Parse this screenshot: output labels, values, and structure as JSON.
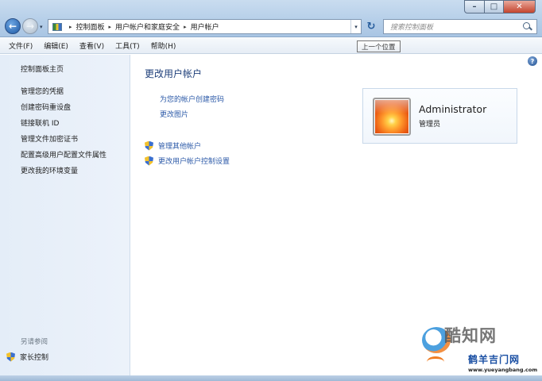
{
  "window": {
    "controls": {
      "minimize": "–",
      "maximize": "□",
      "close": "✕"
    }
  },
  "navigation": {
    "back": "←",
    "forward": "→",
    "history_dropdown": "▾"
  },
  "address_bar": {
    "breadcrumbs": [
      "控制面板",
      "用户帐户和家庭安全",
      "用户帐户"
    ],
    "dropdown": "▾"
  },
  "refresh_button": "↻",
  "search": {
    "placeholder": "搜索控制面板"
  },
  "menu": [
    "文件(F)",
    "编辑(E)",
    "查看(V)",
    "工具(T)",
    "帮助(H)"
  ],
  "tooltip": "上一个位置",
  "sidebar": {
    "home": "控制面板主页",
    "tasks": [
      "管理您的凭据",
      "创建密码重设盘",
      "链接联机 ID",
      "管理文件加密证书",
      "配置高级用户配置文件属性",
      "更改我的环境变量"
    ],
    "see_also_title": "另请参阅",
    "see_also_items": [
      "家长控制"
    ]
  },
  "main": {
    "title": "更改用户帐户",
    "links": [
      "为您的帐户创建密码",
      "更改图片"
    ],
    "shield_links": [
      "管理其他帐户",
      "更改用户帐户控制设置"
    ],
    "help": "?"
  },
  "account": {
    "name": "Administrator",
    "role": "管理员"
  },
  "watermark": {
    "brand": "酷知网",
    "brand2": "鹤羊吉门网",
    "url": "www.yueyangbang.com"
  },
  "icons": {
    "control_panel": "control-panel-icon",
    "uac_shield": "uac-shield-icon",
    "search": "search-icon",
    "help": "help-icon",
    "avatar": "user-avatar-flower"
  },
  "colors": {
    "link": "#2c5aa8",
    "title": "#1e3f7a",
    "sidebar_bg": "#e4edf8"
  }
}
